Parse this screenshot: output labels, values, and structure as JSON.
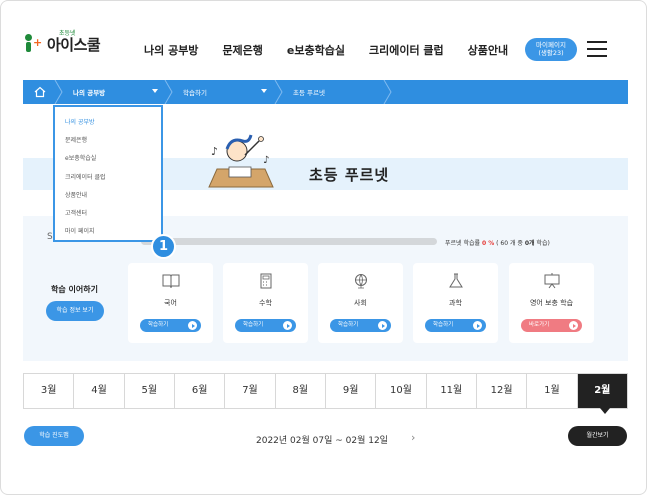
{
  "header": {
    "logo_sub": "초등넷",
    "logo_main": "아이스쿨",
    "nav": [
      "나의 공부방",
      "문제은행",
      "e보충학습실",
      "크리에이터 클럽",
      "상품안내"
    ],
    "mypage_label": "마이페이지",
    "mypage_sub": "(생활23)"
  },
  "breadcrumb": {
    "items": [
      "나의 공부방",
      "학습하기",
      "초등 푸르넷"
    ]
  },
  "dropdown": {
    "items": [
      "나의 공부방",
      "문제은행",
      "e보충학습실",
      "크리에이터 클럽",
      "상품안내",
      "고객센터",
      "마이 페이지"
    ],
    "active_index": 0,
    "step_badge": "1"
  },
  "banner": {
    "title": "초등 푸르넷"
  },
  "study": {
    "hint_char": "S",
    "progress_fraction": 0,
    "progress_prefix": "푸르넷 학습률",
    "progress_percent": "0 %",
    "progress_detail_a": "( 60 개 중 ",
    "progress_detail_b": "0개",
    "progress_detail_c": " 학습)",
    "continue_title": "학습 이어하기",
    "continue_button": "학습 정보 보기",
    "subjects": [
      {
        "name": "국어",
        "button": "학습하기",
        "icon": "book-icon",
        "style": "blue"
      },
      {
        "name": "수학",
        "button": "학습하기",
        "icon": "calculator-icon",
        "style": "blue"
      },
      {
        "name": "사회",
        "button": "학습하기",
        "icon": "globe-icon",
        "style": "blue"
      },
      {
        "name": "과학",
        "button": "학습하기",
        "icon": "flask-icon",
        "style": "blue"
      },
      {
        "name": "영어 보충 학습",
        "button": "바로가기",
        "icon": "english-board-icon",
        "style": "pink"
      }
    ]
  },
  "months": {
    "items": [
      "3월",
      "4월",
      "5월",
      "6월",
      "7월",
      "8월",
      "9월",
      "10월",
      "11월",
      "12월",
      "1월",
      "2월"
    ],
    "active_index": 11
  },
  "footer": {
    "progress_button": "학습 진도맵",
    "date_range": "2022년 02월 07일 ~ 02월 12일",
    "next_arrow": "›",
    "weekly_button": "월간보기"
  },
  "colors": {
    "accent": "#2f8ee0",
    "button_blue": "#3b96e6",
    "button_pink": "#f07b82",
    "panel_bg": "#f2f7fc",
    "banner_bg": "#e5f2fc"
  }
}
